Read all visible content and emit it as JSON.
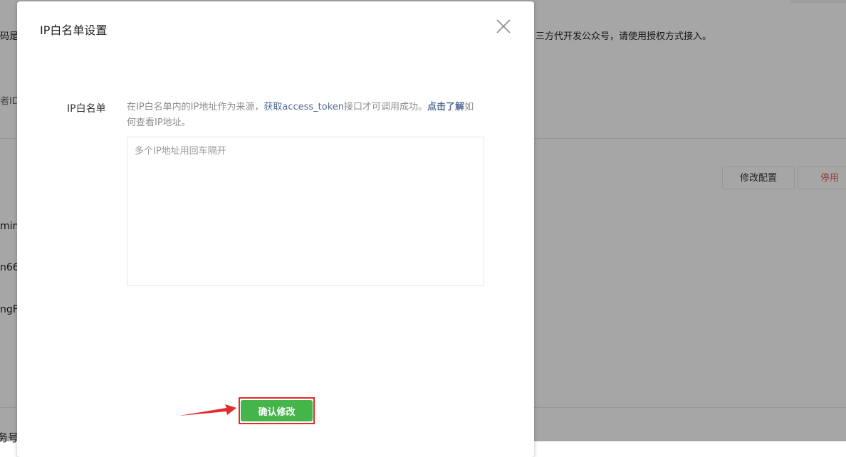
{
  "background": {
    "notice_left": "码是",
    "notice_right": "三方代开发公众号，请使用授权方式接入。",
    "id_label": "者ID",
    "row1": "min",
    "row2": "n66",
    "row3": "ngFo",
    "bottom_label": "务号",
    "modify_config_button": "修改配置",
    "disable_button": "停用"
  },
  "dialog": {
    "title": "IP白名单设置",
    "field_label": "IP白名单",
    "tip": {
      "text_before": "在IP白名单内的IP地址作为来源，",
      "link1": "获取access_token",
      "text_middle": "接口才可调用成功。",
      "link2": "点击了解",
      "text_after": "如何查看IP地址。"
    },
    "textarea": {
      "value": "",
      "placeholder": "多个IP地址用回车隔开"
    },
    "confirm_button": "确认修改"
  },
  "colors": {
    "primary_green": "#44b549",
    "link_blue": "#576b95",
    "highlight_red": "#e22b2b",
    "disable_red": "#e15f63"
  },
  "icons": [
    "close-icon",
    "annotation-arrow-icon"
  ]
}
